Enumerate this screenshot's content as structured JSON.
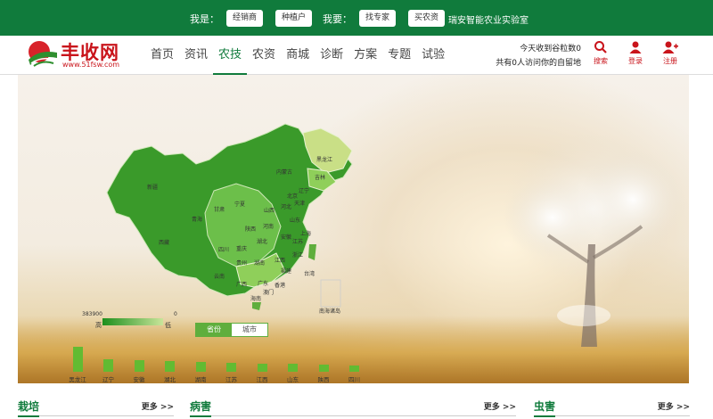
{
  "topbar": {
    "i_am_label": "我是：",
    "i_am_options": [
      "经销商",
      "种植户"
    ],
    "i_want_label": "我要：",
    "i_want_options": [
      "找专家",
      "买农资"
    ],
    "lab_name": "瑞安智能农业实验室"
  },
  "logo": {
    "name": "丰收网",
    "url": "www.51fsw.com"
  },
  "nav": [
    "首页",
    "资讯",
    "农技",
    "农资",
    "商城",
    "诊断",
    "方案",
    "专题",
    "试验"
  ],
  "nav_active": "农技",
  "stats": {
    "line1": "今天收到谷粒数0",
    "line2": "共有0人访问你的自留地"
  },
  "actions": {
    "search": "搜索",
    "login": "登录",
    "register": "注册"
  },
  "map": {
    "legend_max": "383900",
    "legend_min": "0",
    "legend_high": "高",
    "legend_low": "低",
    "toggle": [
      "省份",
      "城市"
    ],
    "toggle_active": "省份",
    "provinces": [
      "黑龙江",
      "吉林",
      "辽宁",
      "内蒙古",
      "新疆",
      "西藏",
      "青海",
      "甘肃",
      "四川",
      "云南",
      "广西",
      "广东",
      "湖南",
      "湖北",
      "河南",
      "河北",
      "山东",
      "江苏",
      "浙江",
      "福建",
      "江西",
      "安徽",
      "山西",
      "陕西",
      "宁夏",
      "贵州",
      "重庆",
      "北京",
      "天津",
      "上海",
      "海南",
      "台湾",
      "香港",
      "澳门",
      "南海诸岛"
    ]
  },
  "chart_data": {
    "type": "bar",
    "categories": [
      "黑龙江",
      "辽宁",
      "安徽",
      "湖北",
      "湖南",
      "江苏",
      "江西",
      "山东",
      "陕西",
      "四川"
    ],
    "values": [
      383900,
      190000,
      175000,
      160000,
      150000,
      140000,
      130000,
      120000,
      110000,
      100000
    ],
    "title": "",
    "xlabel": "",
    "ylabel": ""
  },
  "sections": [
    {
      "title": "栽培",
      "more": "更多 >>"
    },
    {
      "title": "病害",
      "more": "更多 >>"
    },
    {
      "title": "虫害",
      "more": "更多 >>"
    }
  ],
  "colors": {
    "brand_green": "#107b3c",
    "brand_red": "#c9141b",
    "map_green": "#5fae3d"
  }
}
